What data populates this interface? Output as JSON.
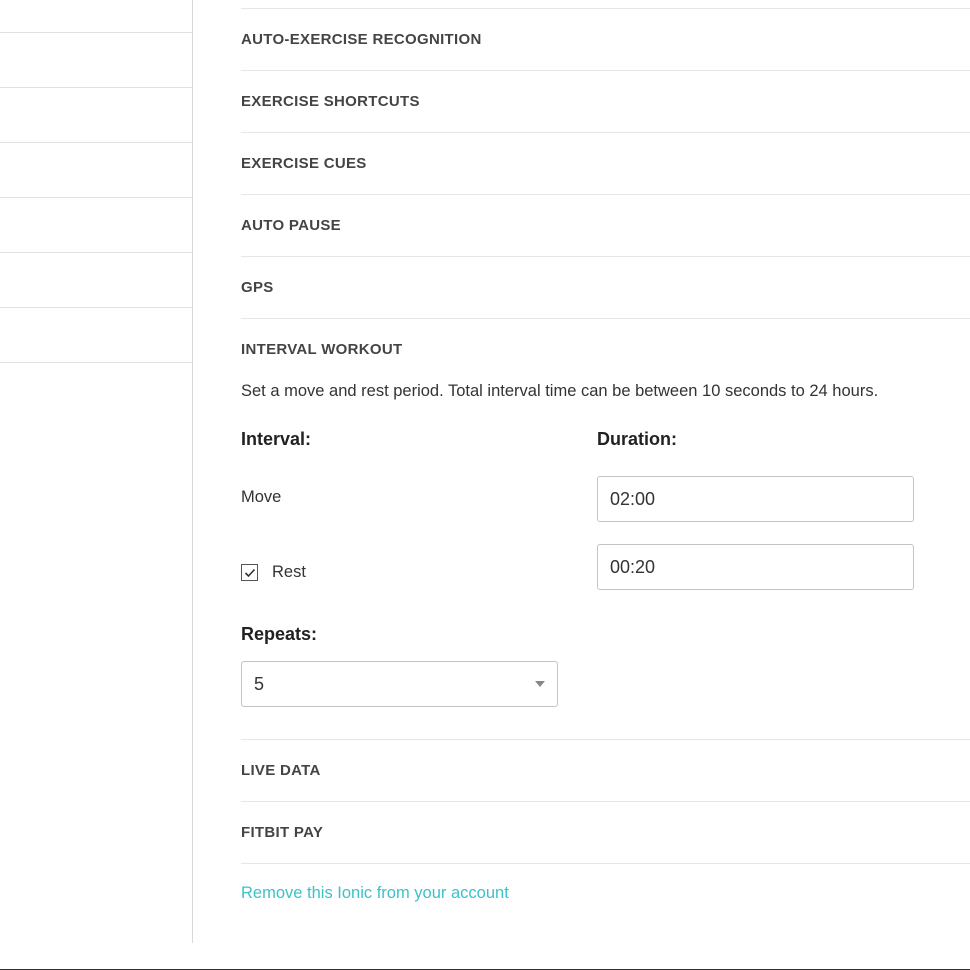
{
  "sections": {
    "auto_exercise": "AUTO-EXERCISE RECOGNITION",
    "exercise_shortcuts": "EXERCISE SHORTCUTS",
    "exercise_cues": "EXERCISE CUES",
    "auto_pause": "AUTO PAUSE",
    "gps": "GPS",
    "interval_workout": "INTERVAL WORKOUT",
    "live_data": "LIVE DATA",
    "fitbit_pay": "FITBIT PAY"
  },
  "interval": {
    "description": "Set a move and rest period. Total interval time can be between 10 seconds to 24 hours.",
    "interval_label": "Interval:",
    "duration_label": "Duration:",
    "move_label": "Move",
    "rest_label": "Rest",
    "rest_checked": true,
    "move_value": "02:00",
    "rest_value": "00:20",
    "repeats_label": "Repeats:",
    "repeats_value": "5"
  },
  "remove_link": "Remove this Ionic from your account"
}
